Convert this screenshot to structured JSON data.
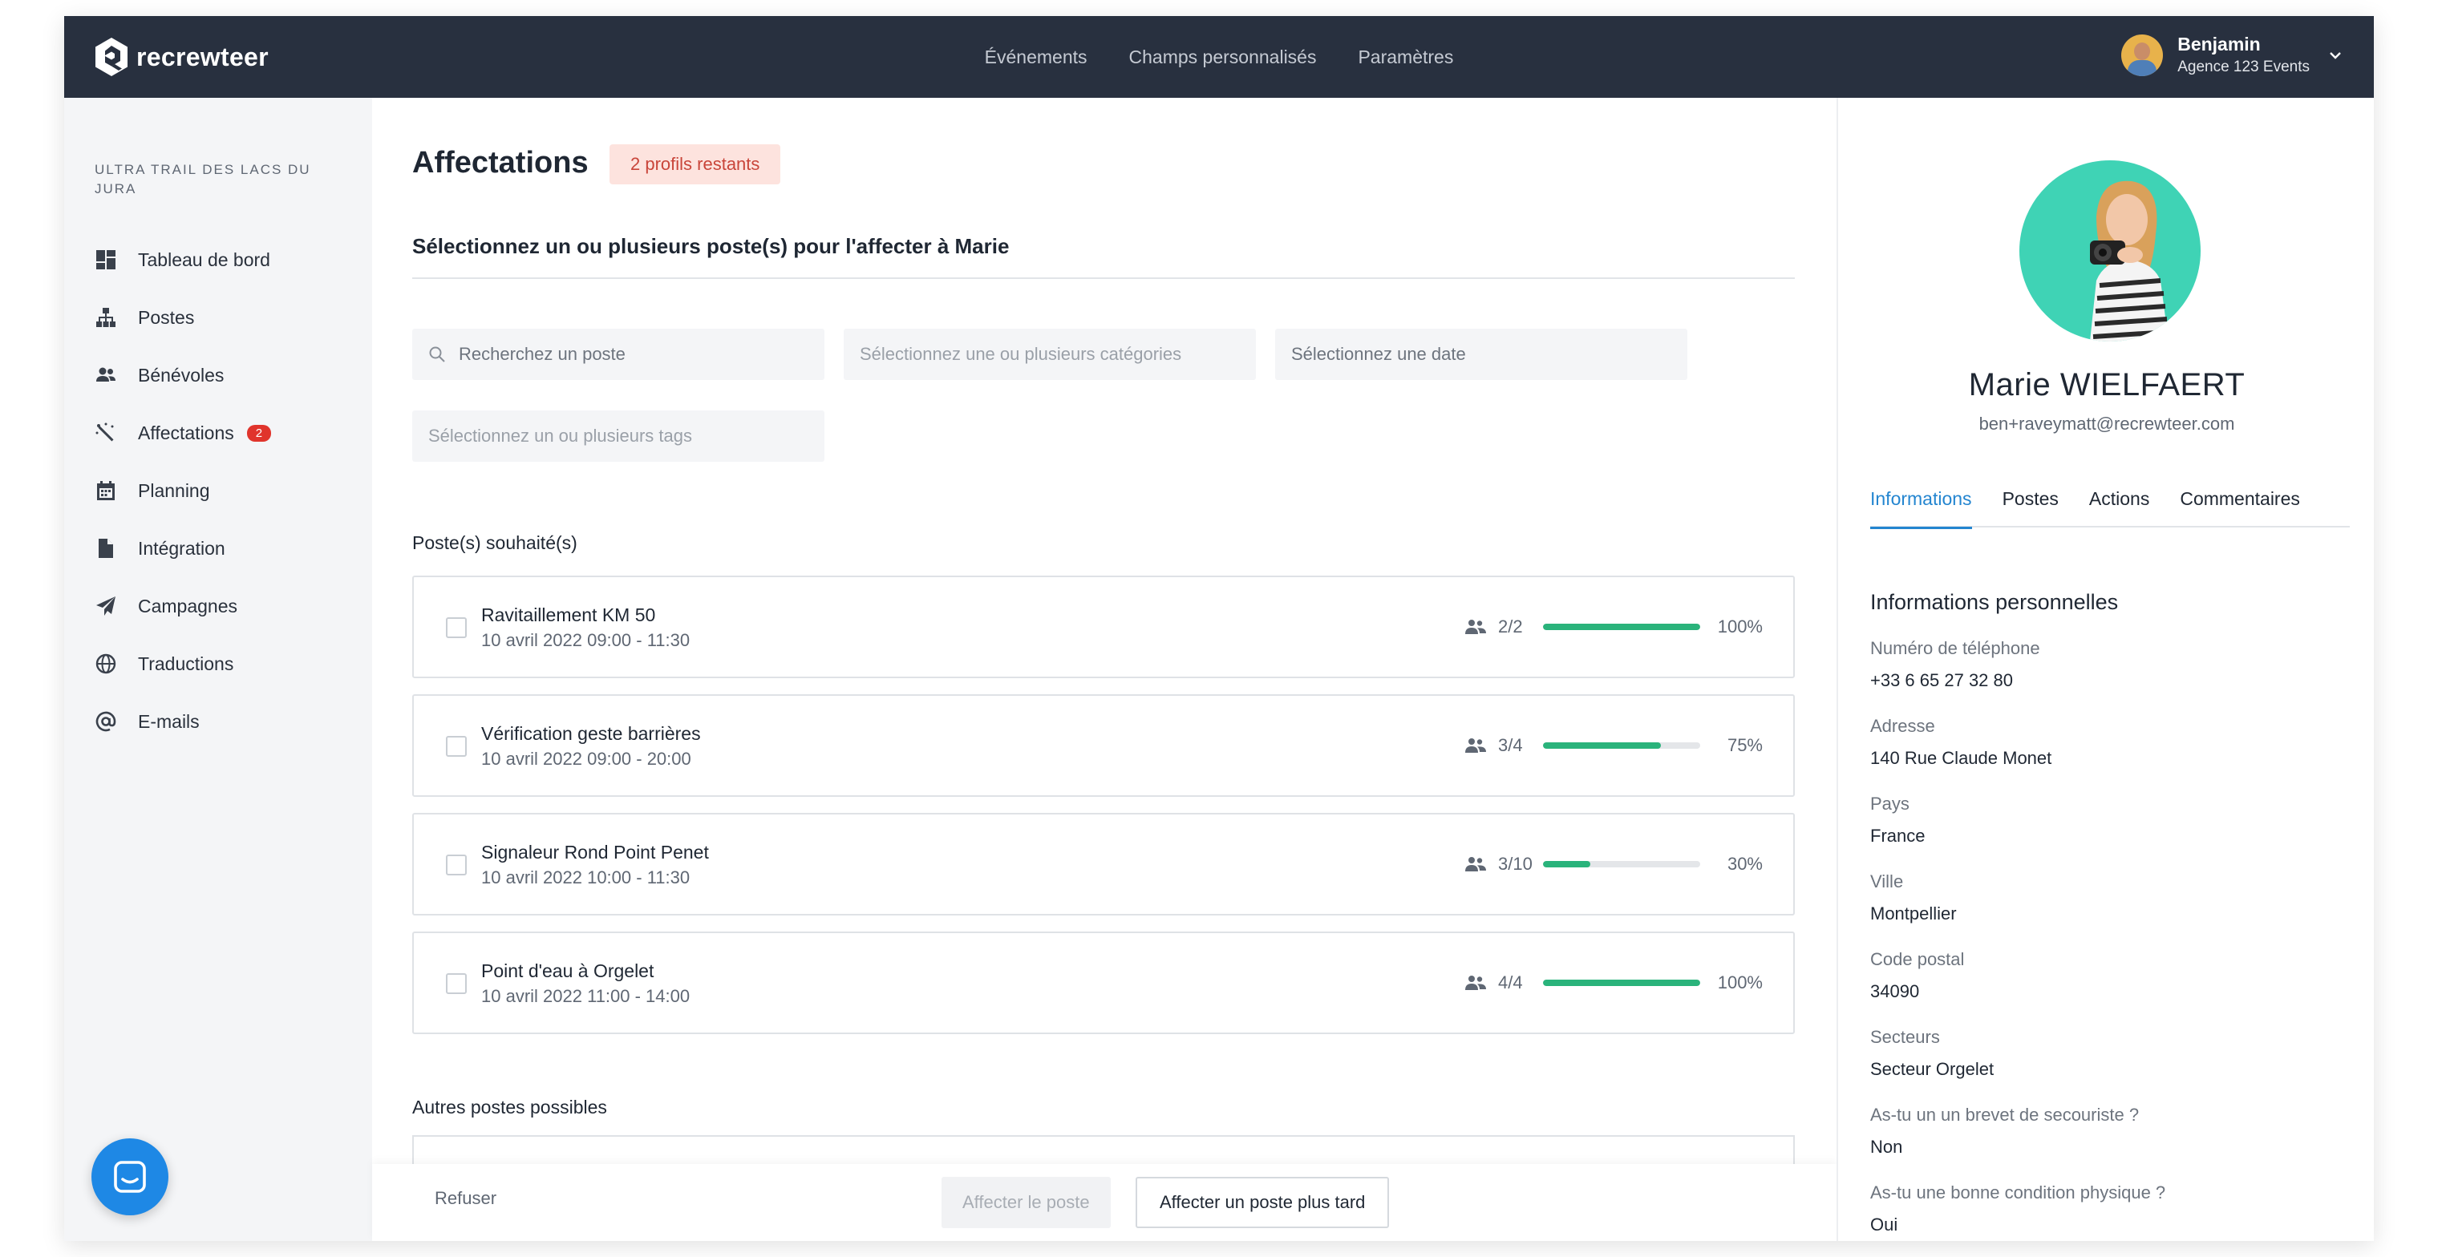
{
  "app": {
    "logo_text": "recrewteer"
  },
  "topnav": {
    "items": [
      "Événements",
      "Champs personnalisés",
      "Paramètres"
    ]
  },
  "user": {
    "name": "Benjamin",
    "company": "Agence 123 Events"
  },
  "sidebar": {
    "event_title": "ULTRA TRAIL DES LACS DU JURA",
    "items": [
      {
        "label": "Tableau de bord",
        "icon": "dashboard-icon"
      },
      {
        "label": "Postes",
        "icon": "sitemap-icon"
      },
      {
        "label": "Bénévoles",
        "icon": "users-icon"
      },
      {
        "label": "Affectations",
        "icon": "magic-wand-icon",
        "badge": "2"
      },
      {
        "label": "Planning",
        "icon": "calendar-icon"
      },
      {
        "label": "Intégration",
        "icon": "document-icon"
      },
      {
        "label": "Campagnes",
        "icon": "paper-plane-icon"
      },
      {
        "label": "Traductions",
        "icon": "globe-icon"
      },
      {
        "label": "E-mails",
        "icon": "at-icon"
      }
    ]
  },
  "main": {
    "title": "Affectations",
    "remaining_badge": "2 profils restants",
    "subtitle": "Sélectionnez un ou plusieurs poste(s) pour l'affecter à Marie",
    "filters": {
      "search_placeholder": "Recherchez un poste",
      "categories_placeholder": "Sélectionnez une ou plusieurs catégories",
      "date_placeholder": "Sélectionnez une date",
      "tags_placeholder": "Sélectionnez un ou plusieurs tags"
    },
    "wished_label": "Poste(s) souhaité(s)",
    "posts": [
      {
        "name": "Ravitaillement KM 50",
        "date": "10 avril 2022 09:00 - 11:30",
        "count": "2/2",
        "percent_label": "100%",
        "percent": 100
      },
      {
        "name": "Vérification geste barrières",
        "date": "10 avril 2022 09:00 - 20:00",
        "count": "3/4",
        "percent_label": "75%",
        "percent": 75
      },
      {
        "name": "Signaleur Rond Point Penet",
        "date": "10 avril 2022 10:00 - 11:30",
        "count": "3/10",
        "percent_label": "30%",
        "percent": 30
      },
      {
        "name": "Point d'eau à Orgelet",
        "date": "10 avril 2022 11:00 - 14:00",
        "count": "4/4",
        "percent_label": "100%",
        "percent": 100
      }
    ],
    "other_label": "Autres postes possibles",
    "footer": {
      "refuse": "Refuser",
      "assign": "Affecter le poste",
      "later": "Affecter un poste plus tard"
    }
  },
  "profile": {
    "name": "Marie WIELFAERT",
    "email": "ben+raveymatt@recrewteer.com",
    "tabs": [
      "Informations",
      "Postes",
      "Actions",
      "Commentaires"
    ],
    "active_tab": "Informations",
    "section_title": "Informations personnelles",
    "fields": [
      {
        "label": "Numéro de téléphone",
        "value": "+33 6 65 27 32 80"
      },
      {
        "label": "Adresse",
        "value": "140 Rue Claude Monet"
      },
      {
        "label": "Pays",
        "value": "France"
      },
      {
        "label": "Ville",
        "value": "Montpellier"
      },
      {
        "label": "Code postal",
        "value": "34090"
      },
      {
        "label": "Secteurs",
        "value": "Secteur Orgelet"
      },
      {
        "label": "As-tu un un brevet de secouriste ?",
        "value": "Non"
      },
      {
        "label": "As-tu une bonne condition physique ?",
        "value": "Oui"
      }
    ]
  },
  "colors": {
    "topbar": "#28303f",
    "accent_blue": "#2385d0",
    "progress_green": "#2ab37b",
    "badge_red": "#e0342c",
    "avatar_teal": "#3fd3b5"
  }
}
